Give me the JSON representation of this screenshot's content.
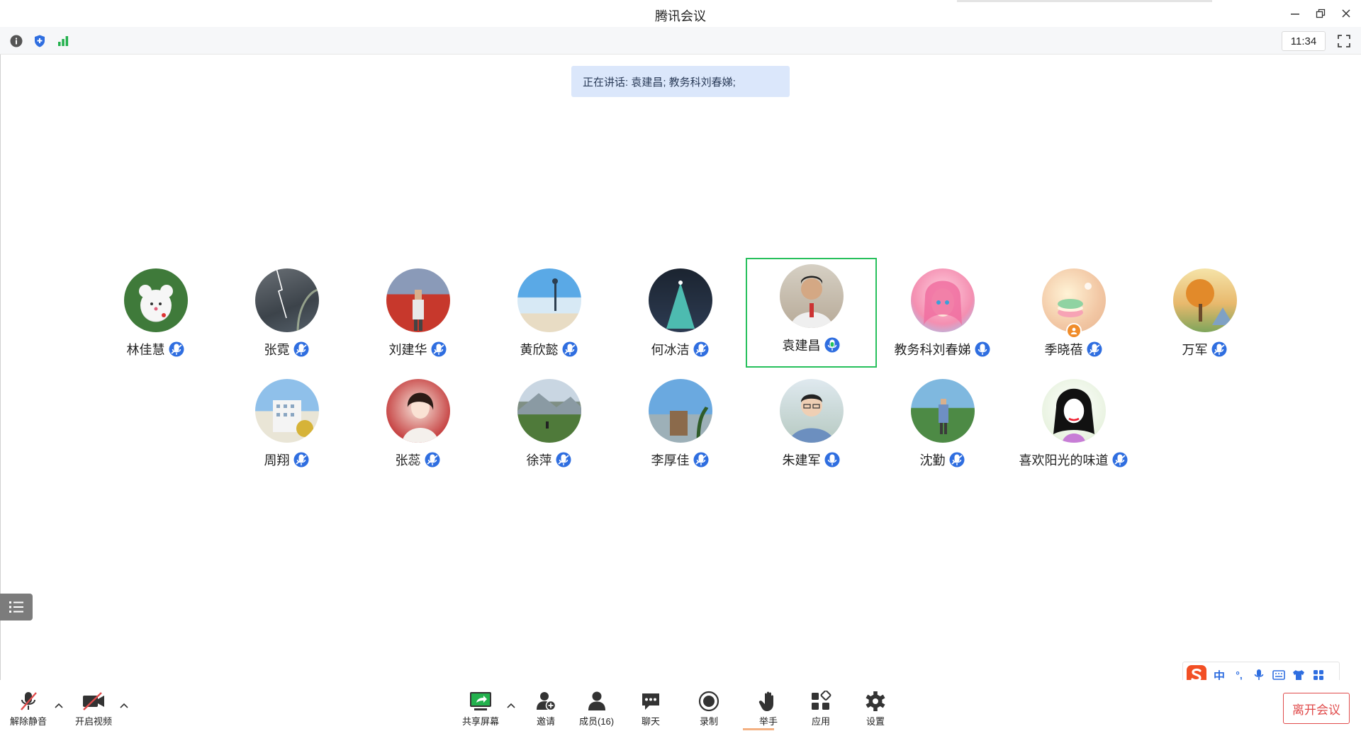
{
  "window": {
    "title": "腾讯会议"
  },
  "topbar": {
    "time": "11:34"
  },
  "speaking": {
    "text": "正在讲话: 袁建昌; 教务科刘春娣;"
  },
  "participants": [
    {
      "name": "林佳慧",
      "mic": "muted"
    },
    {
      "name": "张霓",
      "mic": "muted"
    },
    {
      "name": "刘建华",
      "mic": "muted"
    },
    {
      "name": "黄欣懿",
      "mic": "muted"
    },
    {
      "name": "何冰洁",
      "mic": "muted"
    },
    {
      "name": "袁建昌",
      "mic": "speaking"
    },
    {
      "name": "教务科刘春娣",
      "mic": "on"
    },
    {
      "name": "季晓蓓",
      "mic": "muted"
    },
    {
      "name": "万军",
      "mic": "muted"
    },
    {
      "name": "周翔",
      "mic": "muted"
    },
    {
      "name": "张蕊",
      "mic": "muted"
    },
    {
      "name": "徐萍",
      "mic": "muted"
    },
    {
      "name": "李厚佳",
      "mic": "muted"
    },
    {
      "name": "朱建军",
      "mic": "on"
    },
    {
      "name": "沈勤",
      "mic": "muted"
    },
    {
      "name": "喜欢阳光的味道",
      "mic": "muted"
    }
  ],
  "toolbar": {
    "unmute": "解除静音",
    "video": "开启视频",
    "share": "共享屏幕",
    "invite": "邀请",
    "members": "成员(16)",
    "chat": "聊天",
    "record": "录制",
    "raise_hand": "举手",
    "apps": "应用",
    "settings": "设置",
    "leave": "离开会议"
  },
  "ime": {
    "mode": "中",
    "punct": "°,"
  },
  "colors": {
    "accent": "#2f6ee0",
    "speaking_border": "#27c05c",
    "leave": "#e04b4b"
  }
}
